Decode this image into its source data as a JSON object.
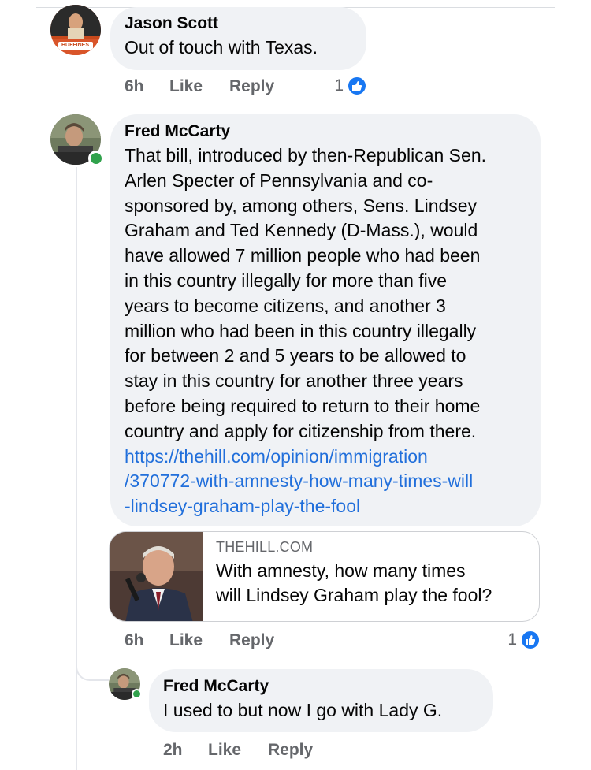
{
  "comments": [
    {
      "author": "Jason Scott",
      "avatar_badge_text": "HUFFINES",
      "text_lines": [
        "Out of touch with Texas."
      ],
      "time": "6h",
      "like_label": "Like",
      "reply_label": "Reply",
      "reaction_count": "1",
      "reaction_icon": "thumbs-up-icon",
      "online": false
    },
    {
      "author": "Fred McCarty",
      "text_lines": [
        "That bill, introduced by then-Republican Sen.",
        "Arlen Specter of Pennsylvania and co-",
        "sponsored by, among others, Sens. Lindsey",
        "Graham and Ted Kennedy (D-Mass.), would",
        "have allowed 7 million people who had been",
        "in this country illegally for more than five",
        "years to become citizens, and another 3",
        "million who had been in this country illegally",
        "for between 2 and 5 years to be allowed to",
        "stay in this country for another three years",
        "before being required to return to their home",
        "country and apply for citizenship from there."
      ],
      "link_lines": [
        "https://thehill.com/opinion/immigration",
        "/370772-with-amnesty-how-many-times-will",
        "-lindsey-graham-play-the-fool"
      ],
      "link_preview": {
        "domain": "THEHILL.COM",
        "title_lines": [
          "With amnesty, how many times",
          "will Lindsey Graham play the fool?"
        ]
      },
      "time": "6h",
      "like_label": "Like",
      "reply_label": "Reply",
      "reaction_count": "1",
      "reaction_icon": "thumbs-up-icon",
      "online": true
    }
  ],
  "reply": {
    "author": "Fred McCarty",
    "text_lines": [
      "I used to but now I go with Lady G."
    ],
    "time": "2h",
    "like_label": "Like",
    "reply_label": "Reply",
    "online": true
  },
  "colors": {
    "bubble": "#f0f2f5",
    "link": "#216fdb",
    "meta_text": "#65676b",
    "like_badge": "#1877f2",
    "online": "#31a24c"
  }
}
